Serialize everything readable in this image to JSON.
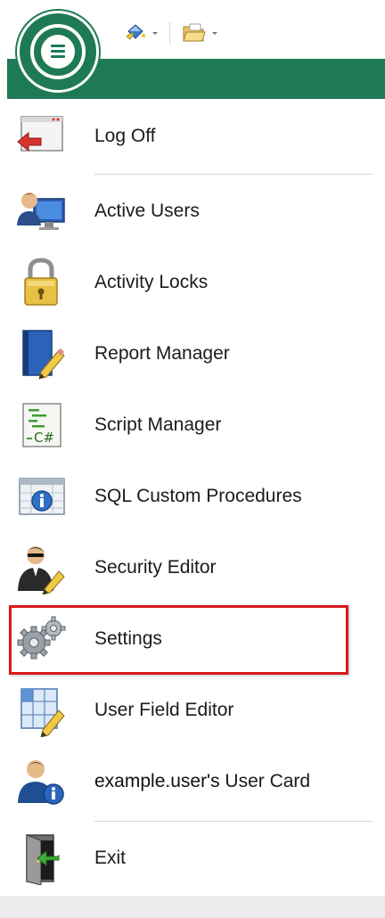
{
  "menu": {
    "items": [
      {
        "id": "log-off",
        "label": "Log Off",
        "icon": "log-off-icon"
      },
      {
        "id": "active-users",
        "label": "Active Users",
        "icon": "active-users-icon"
      },
      {
        "id": "activity-locks",
        "label": "Activity Locks",
        "icon": "padlock-icon"
      },
      {
        "id": "report-manager",
        "label": "Report Manager",
        "icon": "report-book-icon"
      },
      {
        "id": "script-manager",
        "label": "Script Manager",
        "icon": "csharp-script-icon"
      },
      {
        "id": "sql-custom-procedures",
        "label": "SQL Custom Procedures",
        "icon": "info-table-icon"
      },
      {
        "id": "security-editor",
        "label": "Security Editor",
        "icon": "security-agent-icon"
      },
      {
        "id": "settings",
        "label": "Settings",
        "icon": "gears-icon"
      },
      {
        "id": "user-field-editor",
        "label": "User Field Editor",
        "icon": "grid-edit-icon"
      },
      {
        "id": "user-card",
        "label_user": "example.user's",
        "label_suffix": " User Card",
        "icon": "user-info-icon"
      },
      {
        "id": "exit",
        "label": "Exit",
        "icon": "exit-door-icon"
      }
    ],
    "highlighted_item": "Settings"
  },
  "quick_access": {
    "buttons": [
      "paint-bucket-icon",
      "folder-icon"
    ]
  },
  "colors": {
    "accent_green": "#1e7a55",
    "highlight_red": "#d9191e",
    "text": "#1b1b1b"
  }
}
